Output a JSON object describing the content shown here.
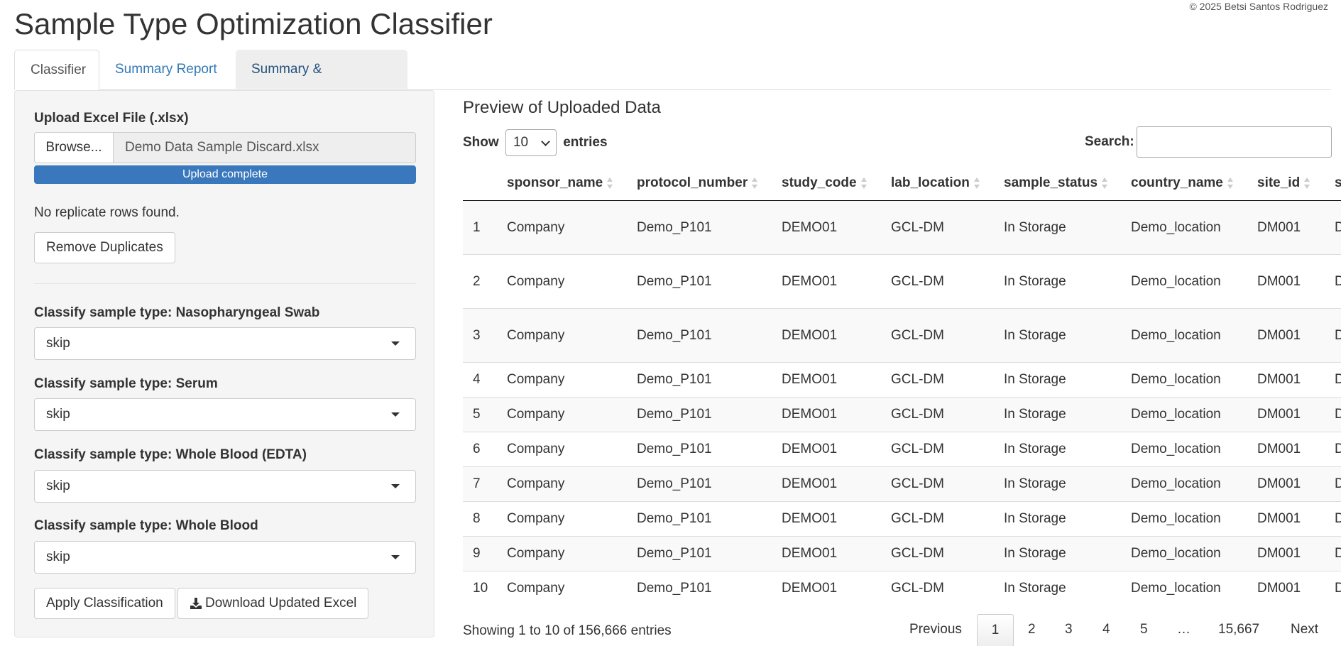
{
  "app": {
    "title": "Sample Type Optimization Classifier",
    "copyright": "© 2025 Betsi Santos Rodriguez"
  },
  "tabs": [
    {
      "label": "Classifier",
      "active": true
    },
    {
      "label": "Summary Report",
      "active": false
    },
    {
      "label": "Summary & Instructions",
      "active": false
    }
  ],
  "sidebar": {
    "upload_label": "Upload Excel File (.xlsx)",
    "browse_label": "Browse...",
    "file_name": "Demo Data Sample Discard.xlsx",
    "progress_text": "Upload complete",
    "progress_value": 1.0,
    "replicate_message": "No replicate rows found.",
    "remove_duplicates_label": "Remove Duplicates",
    "classifiers": [
      {
        "label": "Classify sample type: Nasopharyngeal Swab",
        "value": "skip"
      },
      {
        "label": "Classify sample type: Serum",
        "value": "skip"
      },
      {
        "label": "Classify sample type: Whole Blood (EDTA)",
        "value": "skip"
      },
      {
        "label": "Classify sample type: Whole Blood",
        "value": "skip"
      }
    ],
    "apply_label": "Apply Classification",
    "download_label": "Download Updated Excel"
  },
  "main": {
    "title": "Preview of Uploaded Data",
    "show_label": "Show",
    "entries_label": "entries",
    "page_length": "10",
    "search_label": "Search:",
    "search_value": "",
    "columns": [
      "",
      "sponsor_name",
      "protocol_number",
      "study_code",
      "lab_location",
      "sample_status",
      "country_name",
      "site_id",
      "s"
    ],
    "rows": [
      [
        "1",
        "Company",
        "Demo_P101",
        "DEMO01",
        "GCL-DM",
        "In Storage",
        "Demo_location",
        "DM001",
        "D"
      ],
      [
        "2",
        "Company",
        "Demo_P101",
        "DEMO01",
        "GCL-DM",
        "In Storage",
        "Demo_location",
        "DM001",
        "D"
      ],
      [
        "3",
        "Company",
        "Demo_P101",
        "DEMO01",
        "GCL-DM",
        "In Storage",
        "Demo_location",
        "DM001",
        "D"
      ],
      [
        "4",
        "Company",
        "Demo_P101",
        "DEMO01",
        "GCL-DM",
        "In Storage",
        "Demo_location",
        "DM001",
        "D"
      ],
      [
        "5",
        "Company",
        "Demo_P101",
        "DEMO01",
        "GCL-DM",
        "In Storage",
        "Demo_location",
        "DM001",
        "D"
      ],
      [
        "6",
        "Company",
        "Demo_P101",
        "DEMO01",
        "GCL-DM",
        "In Storage",
        "Demo_location",
        "DM001",
        "D"
      ],
      [
        "7",
        "Company",
        "Demo_P101",
        "DEMO01",
        "GCL-DM",
        "In Storage",
        "Demo_location",
        "DM001",
        "D"
      ],
      [
        "8",
        "Company",
        "Demo_P101",
        "DEMO01",
        "GCL-DM",
        "In Storage",
        "Demo_location",
        "DM001",
        "D"
      ],
      [
        "9",
        "Company",
        "Demo_P101",
        "DEMO01",
        "GCL-DM",
        "In Storage",
        "Demo_location",
        "DM001",
        "D"
      ],
      [
        "10",
        "Company",
        "Demo_P101",
        "DEMO01",
        "GCL-DM",
        "In Storage",
        "Demo_location",
        "DM001",
        "D"
      ]
    ],
    "info": "Showing 1 to 10 of 156,666 entries",
    "pagination": {
      "previous": "Previous",
      "pages": [
        "1",
        "2",
        "3",
        "4",
        "5",
        "…",
        "15,667"
      ],
      "current": "1",
      "next": "Next"
    }
  }
}
